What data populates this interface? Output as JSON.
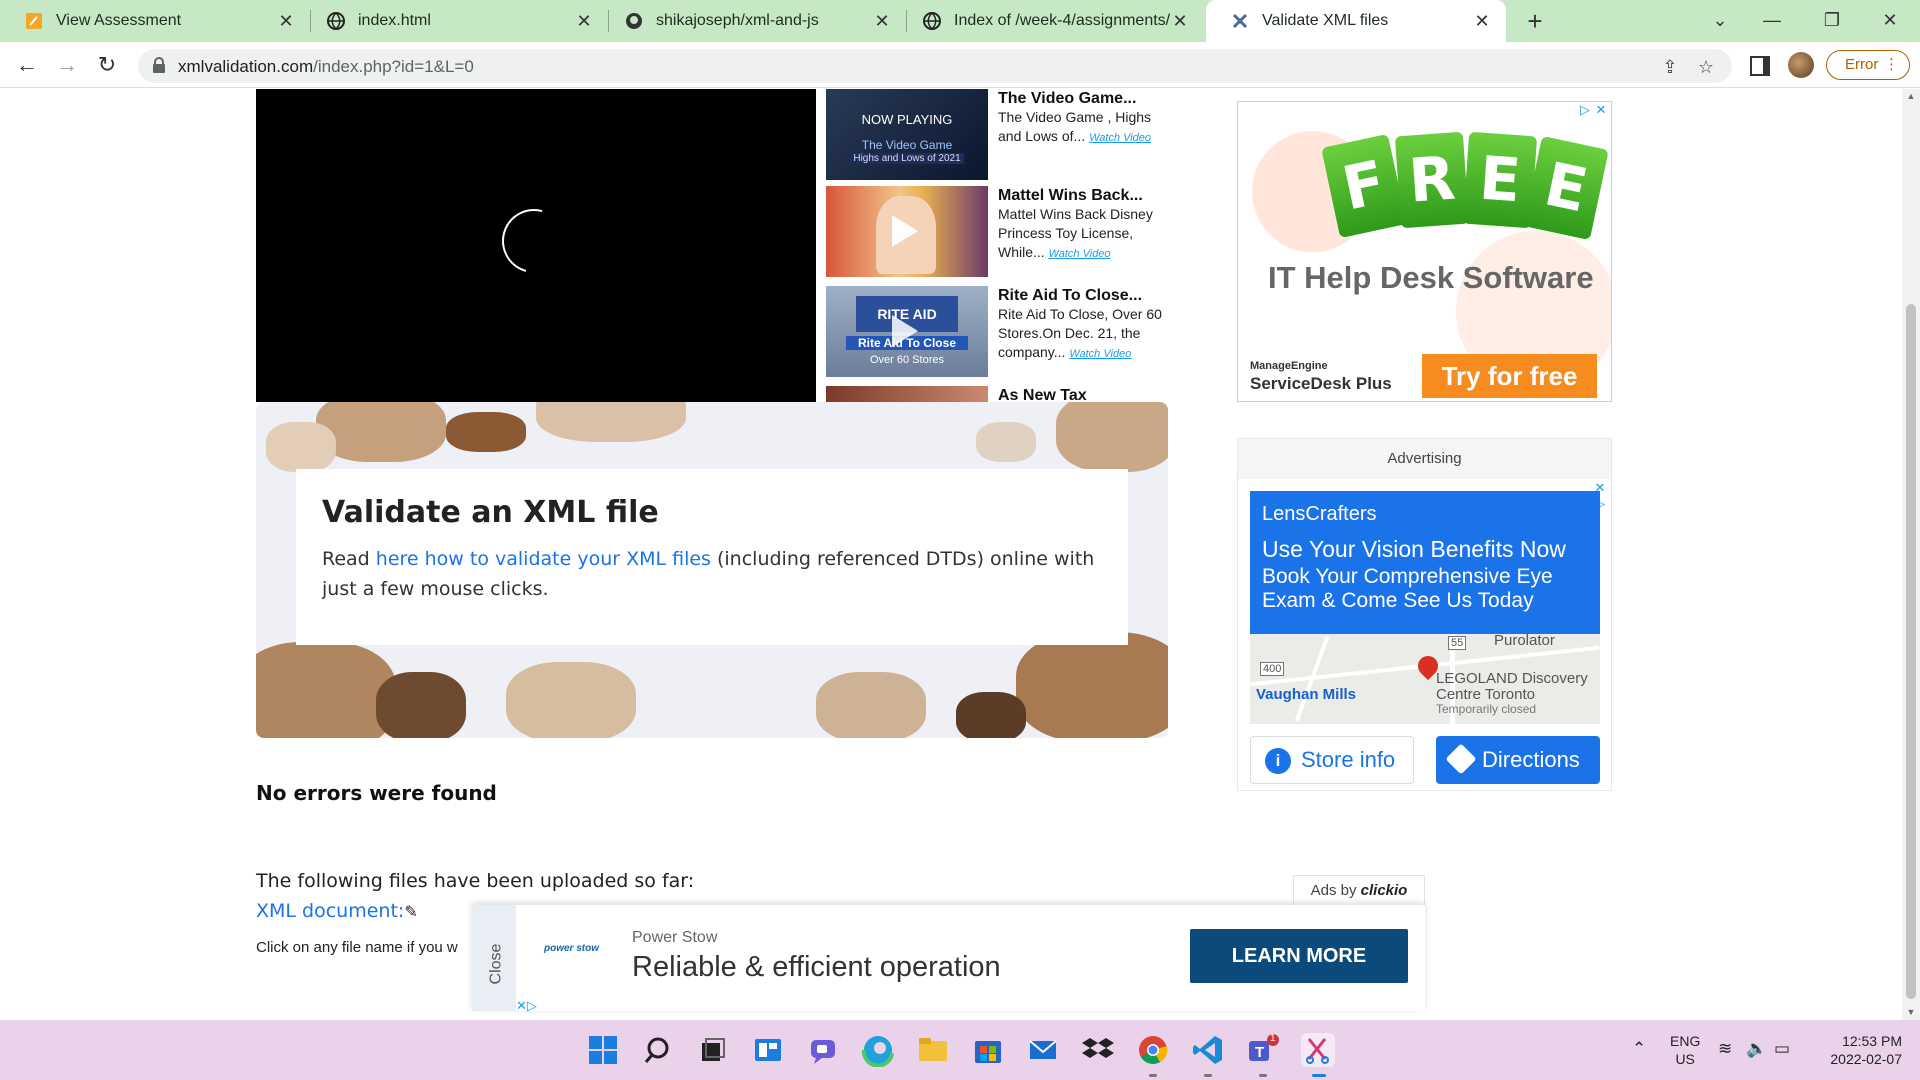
{
  "browser": {
    "tabs": [
      {
        "label": "View Assessment",
        "icon": "edit-icon",
        "active": false
      },
      {
        "label": "index.html",
        "icon": "globe-icon",
        "active": false
      },
      {
        "label": "shikajoseph/xml-and-js",
        "icon": "github-icon",
        "active": false
      },
      {
        "label": "Index of /week-4/assignments/",
        "icon": "globe-icon",
        "active": false
      },
      {
        "label": "Validate XML files",
        "icon": "xml-icon",
        "active": true
      }
    ],
    "url_host": "xmlvalidation.com",
    "url_path": "/index.php?id=1&L=0",
    "profile_status": "Error"
  },
  "video_playlist": [
    {
      "title": "The Video Game...",
      "desc": "The Video Game , Highs and Lows of...",
      "watch": "Watch Video",
      "thumb_overlay": "NOW PLAYING",
      "thumb_caption": "The Video Game",
      "thumb_caption2": "Highs and Lows of 2021"
    },
    {
      "title": "Mattel Wins Back...",
      "desc": "Mattel Wins Back Disney Princess Toy License, While...",
      "watch": "Watch Video"
    },
    {
      "title": "Rite Aid To Close...",
      "desc": "Rite Aid To Close, Over 60 Stores.On Dec. 21, the company...",
      "watch": "Watch Video",
      "thumb_caption": "RITE AID",
      "thumb_caption2": "Rite Aid To Close",
      "thumb_caption3": "Over 60 Stores"
    },
    {
      "title": "As New Tax"
    }
  ],
  "validate": {
    "heading": "Validate an XML file",
    "text_before": "Read ",
    "link_text": "here how to validate your XML files",
    "text_after": " (including referenced DTDs) online with just a few mouse clicks."
  },
  "results": {
    "status": "No errors were found",
    "uploaded_label": "The following files have been uploaded so far:",
    "file_link": "XML document:",
    "click_hint": "Click on any file name if you w"
  },
  "ad_helpdesk": {
    "tag_letters": [
      "F",
      "R",
      "E",
      "E"
    ],
    "headline": "IT Help Desk Software",
    "brand_small": "ManageEngine",
    "brand": "ServiceDesk Plus",
    "cta": "Try for free"
  },
  "ad_lenscrafters": {
    "label": "Advertising",
    "brand": "LensCrafters",
    "headline": "Use Your Vision Benefits Now",
    "sub": "Book Your Comprehensive Eye Exam & Come See Us Today",
    "map_labels": {
      "purolator": "Purolator",
      "vaughan": "Vaughan Mills",
      "legoland": "LEGOLAND Discovery",
      "legoland2": "Centre Toronto",
      "closed": "Temporarily closed",
      "hwy400": "400",
      "hwy55": "55"
    },
    "store_btn": "Store info",
    "dir_btn": "Directions"
  },
  "ad_bottom": {
    "ads_by": "Ads by",
    "ads_vendor": "clickio",
    "close": "Close",
    "logo_text": "power stow",
    "brand": "Power Stow",
    "headline": "Reliable & efficient operation",
    "cta": "LEARN MORE"
  },
  "taskbar": {
    "lang1": "ENG",
    "lang2": "US",
    "time": "12:53 PM",
    "date": "2022-02-07",
    "teams_badge": "1"
  },
  "colors": {
    "tabstrip": "#c7e8c5",
    "link": "#1a73e8",
    "taskbar": "#ead3ea"
  }
}
